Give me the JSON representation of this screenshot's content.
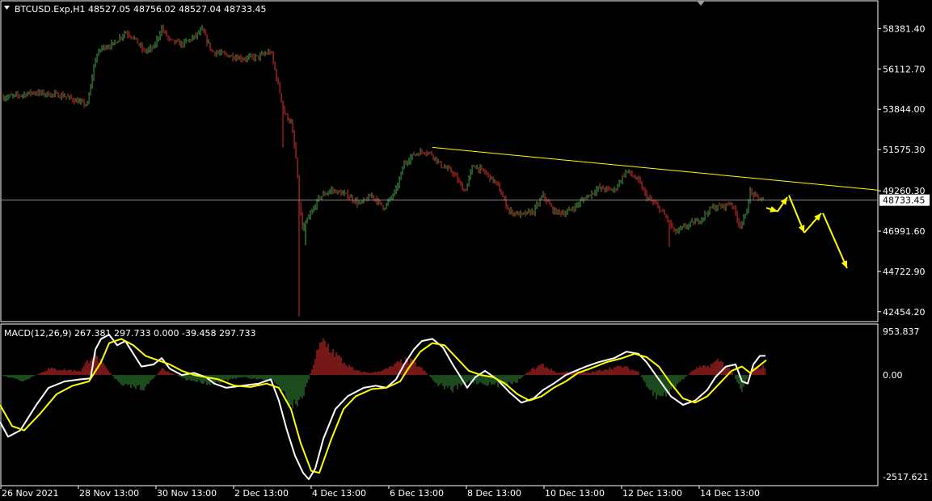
{
  "chart_data": [
    {
      "type": "candlestick",
      "title": "BTCUSD.Exp,H1  48527.05 48756.02 48527.04 48733.45",
      "symbol": "BTCUSD.Exp",
      "timeframe": "H1",
      "ohlc_readout": {
        "open": 48527.05,
        "high": 48756.02,
        "low": 48527.04,
        "close": 48733.45
      },
      "current_price_label": "48733.45",
      "current_price": 48733.45,
      "y_ticks": [
        "58381.40",
        "56112.70",
        "53844.00",
        "51575.30",
        "49260.30",
        "46991.60",
        "44722.90",
        "42454.20"
      ],
      "y_tick_values": [
        58381.4,
        56112.7,
        53844.0,
        51575.3,
        49260.3,
        46991.6,
        44722.9,
        42454.2
      ],
      "ylim": [
        41900,
        59900
      ],
      "x_ticks": [
        "26 Nov 2021",
        "28 Nov 13:00",
        "30 Nov 13:00",
        "2 Dec 13:00",
        "4 Dec 13:00",
        "6 Dec 13:00",
        "8 Dec 13:00",
        "10 Dec 13:00",
        "12 Dec 13:00",
        "14 Dec 13:00"
      ],
      "x_tick_positions": [
        0,
        96,
        192,
        288,
        384,
        480,
        576,
        672,
        768,
        864
      ],
      "close_path": [
        [
          0,
          54500
        ],
        [
          20,
          54600
        ],
        [
          40,
          54800
        ],
        [
          60,
          54700
        ],
        [
          80,
          54600
        ],
        [
          100,
          54200
        ],
        [
          108,
          54100
        ],
        [
          118,
          56700
        ],
        [
          125,
          57300
        ],
        [
          140,
          57500
        ],
        [
          155,
          58200
        ],
        [
          165,
          57900
        ],
        [
          178,
          57100
        ],
        [
          190,
          57300
        ],
        [
          200,
          58400
        ],
        [
          210,
          57700
        ],
        [
          225,
          57500
        ],
        [
          240,
          57900
        ],
        [
          250,
          58300
        ],
        [
          262,
          57100
        ],
        [
          280,
          56900
        ],
        [
          300,
          56700
        ],
        [
          320,
          56800
        ],
        [
          335,
          57100
        ],
        [
          345,
          55000
        ],
        [
          352,
          53600
        ],
        [
          360,
          53100
        ],
        [
          366,
          51100
        ],
        [
          370,
          48600
        ],
        [
          374,
          47100
        ],
        [
          385,
          48000
        ],
        [
          395,
          48900
        ],
        [
          410,
          49300
        ],
        [
          430,
          49000
        ],
        [
          445,
          48500
        ],
        [
          460,
          49000
        ],
        [
          475,
          48300
        ],
        [
          490,
          49300
        ],
        [
          500,
          50800
        ],
        [
          512,
          51300
        ],
        [
          525,
          51500
        ],
        [
          535,
          51300
        ],
        [
          545,
          50700
        ],
        [
          560,
          50300
        ],
        [
          575,
          49200
        ],
        [
          585,
          50700
        ],
        [
          600,
          50300
        ],
        [
          615,
          49600
        ],
        [
          630,
          48100
        ],
        [
          645,
          47900
        ],
        [
          660,
          48100
        ],
        [
          672,
          49000
        ],
        [
          685,
          48100
        ],
        [
          700,
          48000
        ],
        [
          712,
          48400
        ],
        [
          725,
          48900
        ],
        [
          740,
          49400
        ],
        [
          760,
          49300
        ],
        [
          775,
          50400
        ],
        [
          790,
          49800
        ],
        [
          800,
          48900
        ],
        [
          815,
          48300
        ],
        [
          825,
          47700
        ],
        [
          835,
          46900
        ],
        [
          850,
          47300
        ],
        [
          865,
          47600
        ],
        [
          880,
          48300
        ],
        [
          895,
          48400
        ],
        [
          905,
          48600
        ],
        [
          915,
          47300
        ],
        [
          922,
          47800
        ],
        [
          928,
          49200
        ],
        [
          935,
          48900
        ],
        [
          945,
          48700
        ]
      ],
      "spikes": [
        {
          "x": 370,
          "low": 42200
        },
        {
          "x": 350,
          "low": 51700
        },
        {
          "x": 378,
          "low": 46200
        },
        {
          "x": 828,
          "low": 46100
        }
      ],
      "trendline": {
        "start": {
          "x": 535,
          "price": 51700
        },
        "end": {
          "x": 1086,
          "price": 49300
        },
        "color": "#ffff00"
      },
      "projection_arrows": [
        {
          "from": {
            "x": 948,
            "price": 48300
          },
          "to": {
            "x": 962,
            "price": 48100
          }
        },
        {
          "from": {
            "x": 962,
            "price": 48100
          },
          "to": {
            "x": 974,
            "price": 48900
          }
        },
        {
          "from": {
            "x": 976,
            "price": 49000
          },
          "to": {
            "x": 995,
            "price": 46900
          }
        },
        {
          "from": {
            "x": 995,
            "price": 46900
          },
          "to": {
            "x": 1016,
            "price": 48000
          }
        },
        {
          "from": {
            "x": 1018,
            "price": 48000
          },
          "to": {
            "x": 1048,
            "price": 44900
          }
        }
      ],
      "colors": {
        "bull": "#2e8b3a",
        "bear": "#c62828",
        "line_bull": "#4caf50",
        "line_bear": "#d32f2f",
        "trendline": "#ffff00",
        "arrows": "#ffff00",
        "background": "#000000",
        "text": "#ffffff"
      }
    },
    {
      "type": "line",
      "title": "MACD(12,26,9) 267.381 297.733 0.000 -39.458 297.733",
      "y_ticks": [
        "953.837",
        "0.00",
        "-2517.621"
      ],
      "y_tick_values": [
        953.837,
        0.0,
        -2517.621
      ],
      "ylim": [
        -2600,
        1180
      ],
      "series": [
        {
          "name": "white",
          "color": "#ffffff",
          "points": [
            [
              0,
              -1100
            ],
            [
              10,
              -1450
            ],
            [
              25,
              -1300
            ],
            [
              45,
              -700
            ],
            [
              60,
              -300
            ],
            [
              80,
              -150
            ],
            [
              100,
              -100
            ],
            [
              112,
              -80
            ],
            [
              118,
              600
            ],
            [
              125,
              850
            ],
            [
              135,
              950
            ],
            [
              145,
              700
            ],
            [
              155,
              800
            ],
            [
              165,
              500
            ],
            [
              175,
              200
            ],
            [
              190,
              250
            ],
            [
              200,
              400
            ],
            [
              210,
              150
            ],
            [
              225,
              0
            ],
            [
              240,
              50
            ],
            [
              255,
              -50
            ],
            [
              265,
              -200
            ],
            [
              280,
              -300
            ],
            [
              300,
              -250
            ],
            [
              320,
              -200
            ],
            [
              335,
              -100
            ],
            [
              345,
              -600
            ],
            [
              355,
              -1300
            ],
            [
              365,
              -1900
            ],
            [
              375,
              -2300
            ],
            [
              382,
              -2450
            ],
            [
              390,
              -2200
            ],
            [
              400,
              -1500
            ],
            [
              415,
              -800
            ],
            [
              430,
              -500
            ],
            [
              450,
              -300
            ],
            [
              465,
              -250
            ],
            [
              478,
              -300
            ],
            [
              490,
              -100
            ],
            [
              500,
              250
            ],
            [
              512,
              600
            ],
            [
              522,
              800
            ],
            [
              535,
              850
            ],
            [
              548,
              650
            ],
            [
              560,
              250
            ],
            [
              570,
              -50
            ],
            [
              578,
              -300
            ],
            [
              588,
              -50
            ],
            [
              600,
              100
            ],
            [
              615,
              -100
            ],
            [
              630,
              -400
            ],
            [
              645,
              -650
            ],
            [
              660,
              -550
            ],
            [
              672,
              -350
            ],
            [
              685,
              -200
            ],
            [
              700,
              0
            ],
            [
              712,
              100
            ],
            [
              725,
              200
            ],
            [
              740,
              300
            ],
            [
              760,
              400
            ],
            [
              775,
              550
            ],
            [
              790,
              500
            ],
            [
              800,
              300
            ],
            [
              815,
              -100
            ],
            [
              830,
              -500
            ],
            [
              845,
              -700
            ],
            [
              860,
              -600
            ],
            [
              875,
              -350
            ],
            [
              885,
              -50
            ],
            [
              898,
              200
            ],
            [
              910,
              250
            ],
            [
              918,
              -150
            ],
            [
              925,
              -200
            ],
            [
              932,
              250
            ],
            [
              940,
              450
            ],
            [
              947,
              450
            ]
          ]
        },
        {
          "name": "yellow",
          "color": "#ffff00",
          "points": [
            [
              0,
              -700
            ],
            [
              15,
              -1200
            ],
            [
              30,
              -1300
            ],
            [
              50,
              -900
            ],
            [
              70,
              -450
            ],
            [
              90,
              -250
            ],
            [
              110,
              -150
            ],
            [
              125,
              300
            ],
            [
              135,
              750
            ],
            [
              150,
              850
            ],
            [
              165,
              700
            ],
            [
              180,
              450
            ],
            [
              195,
              350
            ],
            [
              210,
              250
            ],
            [
              225,
              100
            ],
            [
              240,
              0
            ],
            [
              255,
              -50
            ],
            [
              270,
              -100
            ],
            [
              290,
              -250
            ],
            [
              310,
              -280
            ],
            [
              330,
              -200
            ],
            [
              345,
              -300
            ],
            [
              360,
              -800
            ],
            [
              372,
              -1600
            ],
            [
              385,
              -2250
            ],
            [
              395,
              -2300
            ],
            [
              410,
              -1500
            ],
            [
              425,
              -800
            ],
            [
              440,
              -500
            ],
            [
              460,
              -330
            ],
            [
              478,
              -300
            ],
            [
              495,
              -150
            ],
            [
              505,
              150
            ],
            [
              520,
              550
            ],
            [
              535,
              750
            ],
            [
              550,
              700
            ],
            [
              565,
              400
            ],
            [
              580,
              100
            ],
            [
              595,
              0
            ],
            [
              610,
              -50
            ],
            [
              625,
              -200
            ],
            [
              640,
              -450
            ],
            [
              655,
              -600
            ],
            [
              670,
              -500
            ],
            [
              685,
              -300
            ],
            [
              700,
              -150
            ],
            [
              715,
              50
            ],
            [
              730,
              150
            ],
            [
              750,
              300
            ],
            [
              770,
              400
            ],
            [
              785,
              500
            ],
            [
              800,
              420
            ],
            [
              815,
              200
            ],
            [
              830,
              -200
            ],
            [
              845,
              -550
            ],
            [
              860,
              -650
            ],
            [
              875,
              -500
            ],
            [
              890,
              -200
            ],
            [
              905,
              100
            ],
            [
              918,
              200
            ],
            [
              928,
              50
            ],
            [
              938,
              200
            ],
            [
              948,
              350
            ]
          ]
        }
      ],
      "histogram_profile": [
        [
          0,
          0
        ],
        [
          30,
          -150
        ],
        [
          60,
          150
        ],
        [
          100,
          100
        ],
        [
          115,
          500
        ],
        [
          125,
          300
        ],
        [
          150,
          -250
        ],
        [
          180,
          -300
        ],
        [
          200,
          150
        ],
        [
          230,
          -100
        ],
        [
          260,
          -200
        ],
        [
          300,
          -50
        ],
        [
          340,
          -150
        ],
        [
          350,
          -400
        ],
        [
          360,
          -700
        ],
        [
          372,
          -600
        ],
        [
          380,
          -200
        ],
        [
          392,
          500
        ],
        [
          400,
          800
        ],
        [
          410,
          600
        ],
        [
          425,
          300
        ],
        [
          440,
          100
        ],
        [
          460,
          50
        ],
        [
          480,
          150
        ],
        [
          500,
          350
        ],
        [
          512,
          300
        ],
        [
          525,
          100
        ],
        [
          540,
          -200
        ],
        [
          560,
          -350
        ],
        [
          580,
          -150
        ],
        [
          600,
          -200
        ],
        [
          620,
          -250
        ],
        [
          640,
          -150
        ],
        [
          655,
          100
        ],
        [
          670,
          250
        ],
        [
          690,
          50
        ],
        [
          710,
          100
        ],
        [
          730,
          50
        ],
        [
          750,
          150
        ],
        [
          770,
          200
        ],
        [
          790,
          80
        ],
        [
          800,
          -300
        ],
        [
          815,
          -550
        ],
        [
          830,
          -350
        ],
        [
          845,
          -100
        ],
        [
          860,
          150
        ],
        [
          875,
          200
        ],
        [
          890,
          350
        ],
        [
          905,
          100
        ],
        [
          918,
          -350
        ],
        [
          930,
          150
        ],
        [
          945,
          200
        ]
      ],
      "histogram_colors": {
        "positive": "#c62828",
        "negative": "#2e7d32"
      }
    }
  ]
}
